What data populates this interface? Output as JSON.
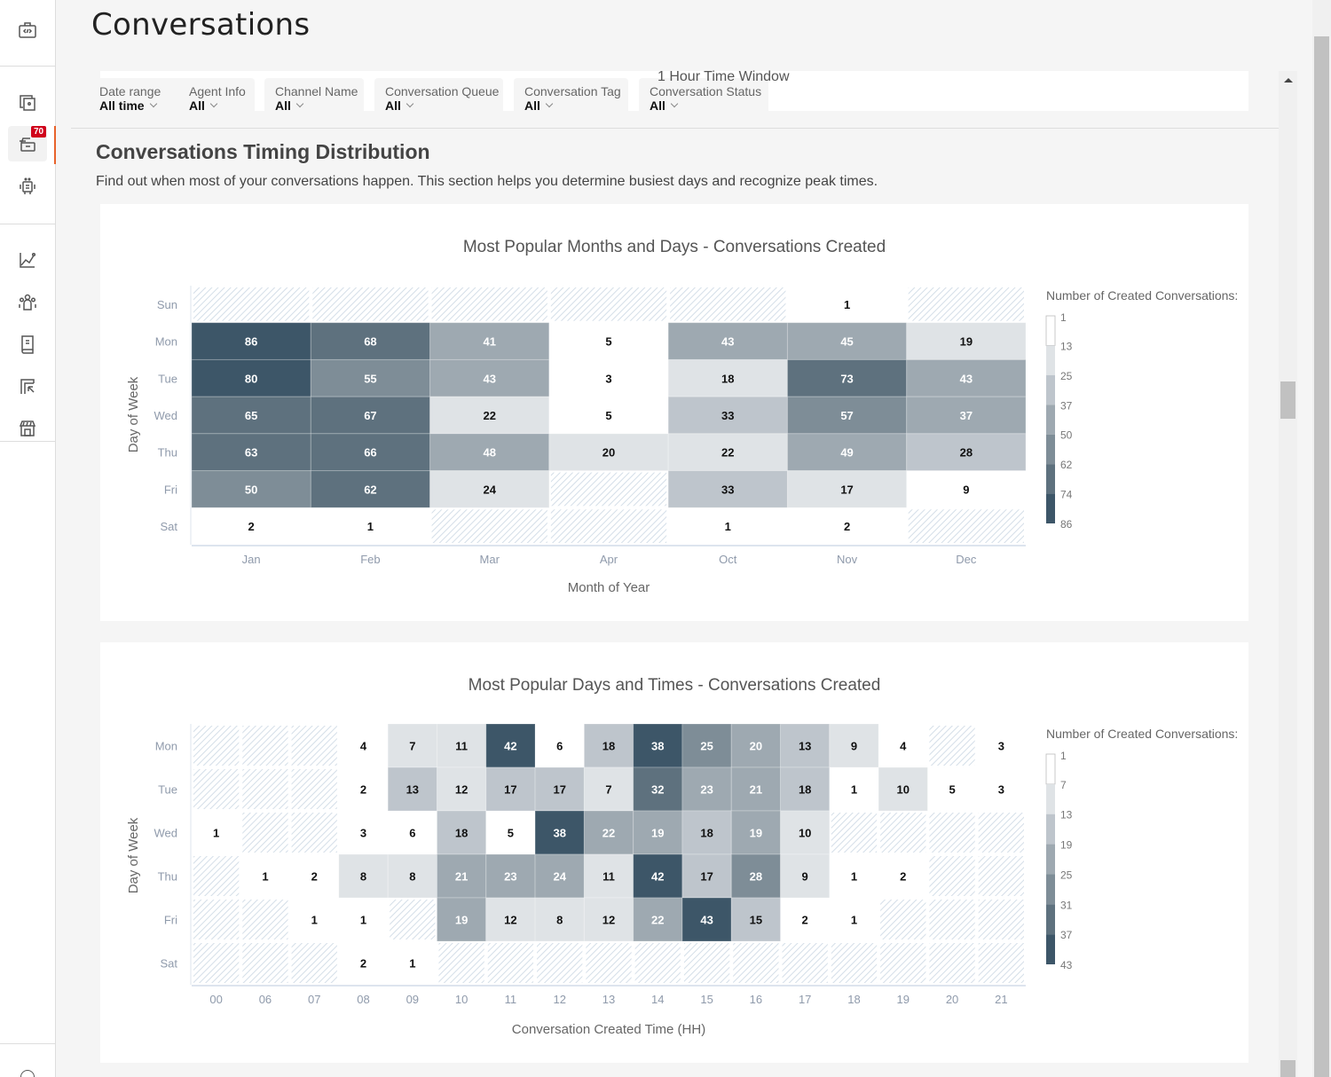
{
  "page": {
    "title": "Conversations"
  },
  "sidebar": {
    "items": [
      {
        "icon": "developer-briefcase-icon",
        "active": false
      },
      {
        "icon": "document-search-icon",
        "active": false
      },
      {
        "icon": "inbox-icon",
        "active": true,
        "badge": "70"
      },
      {
        "icon": "bot-icon",
        "active": false
      },
      {
        "icon": "analytics-chart-icon",
        "active": false
      },
      {
        "icon": "users-group-icon",
        "active": false
      },
      {
        "icon": "knowledge-book-icon",
        "active": false
      },
      {
        "icon": "report-cursor-icon",
        "active": false
      },
      {
        "icon": "storefront-icon",
        "active": false
      }
    ]
  },
  "filters": [
    {
      "label": "Date range",
      "value": "All time"
    },
    {
      "label": "Agent Info",
      "value": "All"
    },
    {
      "label": "Channel Name",
      "value": "All"
    },
    {
      "label": "Conversation Queue",
      "value": "All"
    },
    {
      "label": "Conversation Tag",
      "value": "All"
    },
    {
      "label": "Conversation Status",
      "value": "All"
    }
  ],
  "time_window_label": "1 Hour Time Window",
  "section": {
    "title": "Conversations Timing Distribution",
    "description": "Find out when most of your conversations happen. This section helps you determine busiest days and recognize peak times."
  },
  "colors": {
    "scale": [
      "#ffffff",
      "#dfe3e6",
      "#bec5cc",
      "#9ea9b1",
      "#7e8d97",
      "#5e717e",
      "#3d5668"
    ],
    "hatch": "#d4dee8",
    "axis": "#dde4ee"
  },
  "chart_data": [
    {
      "type": "heatmap",
      "title": "Most Popular Months and Days - Conversations Created",
      "xlabel": "Month of Year",
      "ylabel": "Day of Week",
      "x": [
        "Jan",
        "Feb",
        "Mar",
        "Apr",
        "Oct",
        "Nov",
        "Dec"
      ],
      "y": [
        "Sun",
        "Mon",
        "Tue",
        "Wed",
        "Thu",
        "Fri",
        "Sat"
      ],
      "values": [
        [
          null,
          null,
          null,
          null,
          null,
          1,
          null
        ],
        [
          86,
          68,
          41,
          5,
          43,
          45,
          19
        ],
        [
          80,
          55,
          43,
          3,
          18,
          73,
          43
        ],
        [
          65,
          67,
          22,
          5,
          33,
          57,
          37
        ],
        [
          63,
          66,
          48,
          20,
          22,
          49,
          28
        ],
        [
          50,
          62,
          24,
          null,
          33,
          17,
          9
        ],
        [
          2,
          1,
          null,
          null,
          1,
          2,
          null
        ]
      ],
      "legend": {
        "title": "Number of Created Conversations:",
        "breaks": [
          1,
          13,
          25,
          37,
          50,
          62,
          74,
          86
        ]
      }
    },
    {
      "type": "heatmap",
      "title": "Most Popular Days and Times - Conversations Created",
      "xlabel": "Conversation Created Time (HH)",
      "ylabel": "Day of Week",
      "x": [
        "00",
        "06",
        "07",
        "08",
        "09",
        "10",
        "11",
        "12",
        "13",
        "14",
        "15",
        "16",
        "17",
        "18",
        "19",
        "20",
        "21"
      ],
      "y": [
        "Mon",
        "Tue",
        "Wed",
        "Thu",
        "Fri",
        "Sat"
      ],
      "values": [
        [
          null,
          null,
          null,
          4,
          7,
          11,
          42,
          6,
          18,
          38,
          25,
          20,
          13,
          9,
          4,
          null,
          3
        ],
        [
          null,
          null,
          null,
          2,
          13,
          12,
          17,
          17,
          7,
          32,
          23,
          21,
          18,
          1,
          10,
          5,
          3
        ],
        [
          1,
          null,
          null,
          3,
          6,
          18,
          5,
          38,
          22,
          19,
          18,
          19,
          10,
          null,
          null,
          null,
          null
        ],
        [
          null,
          1,
          2,
          8,
          8,
          21,
          23,
          24,
          11,
          42,
          17,
          28,
          9,
          1,
          2,
          null,
          null
        ],
        [
          null,
          null,
          1,
          1,
          null,
          19,
          12,
          8,
          12,
          22,
          43,
          15,
          2,
          1,
          null,
          null,
          null
        ],
        [
          null,
          null,
          null,
          2,
          1,
          null,
          null,
          null,
          null,
          null,
          null,
          null,
          null,
          null,
          null,
          null,
          null
        ]
      ],
      "legend": {
        "title": "Number of Created Conversations:",
        "breaks": [
          1,
          7,
          13,
          19,
          25,
          31,
          37,
          43
        ]
      }
    }
  ]
}
